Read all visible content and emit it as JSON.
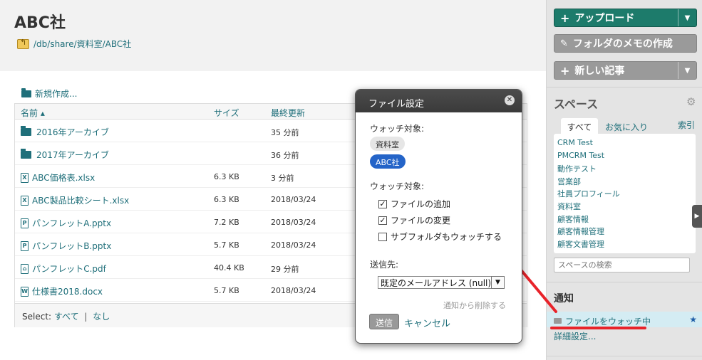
{
  "page": {
    "title": "ABC社",
    "breadcrumb": "/db/share/資料室/ABC社"
  },
  "files": {
    "new_label": "新規作成...",
    "columns": {
      "name": "名前 ▴",
      "size": "サイズ",
      "updated": "最終更新"
    },
    "rows": [
      {
        "name": "2016年アーカイブ",
        "type": "folder",
        "size": "",
        "date": "35 分前"
      },
      {
        "name": "2017年アーカイブ",
        "type": "folder",
        "size": "",
        "date": "36 分前"
      },
      {
        "name": "ABC価格表.xlsx",
        "type": "xlsx",
        "size": "6.3 KB",
        "date": "3 分前"
      },
      {
        "name": "ABC製品比較シート.xlsx",
        "type": "xlsx",
        "size": "6.3 KB",
        "date": "2018/03/24"
      },
      {
        "name": "パンフレットA.pptx",
        "type": "pptx",
        "size": "7.2 KB",
        "date": "2018/03/24"
      },
      {
        "name": "パンフレットB.pptx",
        "type": "pptx",
        "size": "5.7 KB",
        "date": "2018/03/24"
      },
      {
        "name": "パンフレットC.pdf",
        "type": "pdf",
        "size": "40.4 KB",
        "date": "29 分前"
      },
      {
        "name": "仕様書2018.docx",
        "type": "docx",
        "size": "5.7 KB",
        "date": "2018/03/24"
      }
    ],
    "select_label": "Select:",
    "select_all": "すべて",
    "select_sep": "|",
    "select_none": "なし"
  },
  "sidebar": {
    "upload": "アップロード",
    "memo": "フォルダのメモの作成",
    "new_article": "新しい記事",
    "space_title": "スペース",
    "tab_all": "すべて",
    "tab_fav": "お気に入り",
    "tab_index": "索引",
    "spaces": [
      "CRM Test",
      "PMCRM Test",
      "動作テスト",
      "営業部",
      "社員プロフィール",
      "資料室",
      "顧客情報",
      "顧客情報管理",
      "顧客文書管理"
    ],
    "space_search_placeholder": "スペースの検索",
    "notify_title": "通知",
    "notify_item": "ファイルをウォッチ中",
    "detail_link": "詳細設定..."
  },
  "modal": {
    "title": "ファイル設定",
    "watch_target_label": "ウォッチ対象:",
    "targets": [
      "資料室",
      "ABC社"
    ],
    "watch_type_label": "ウォッチ対象:",
    "options": [
      {
        "label": "ファイルの追加",
        "checked": true
      },
      {
        "label": "ファイルの変更",
        "checked": true
      },
      {
        "label": "サブフォルダもウォッチする",
        "checked": false
      }
    ],
    "send_to_label": "送信先:",
    "send_to_value": "既定のメールアドレス (null)",
    "remove_label": "通知から削除する",
    "send_button": "送信",
    "cancel": "キャンセル"
  },
  "colors": {
    "accent": "#1f6f7a",
    "primary_button": "#1d7b6b",
    "annotation": "#e8232a",
    "pill_selected": "#2464c8"
  }
}
